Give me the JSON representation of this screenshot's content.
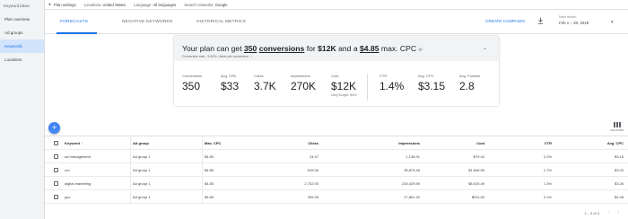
{
  "sidebar": {
    "title": "Keyword ideas",
    "items": [
      {
        "label": "Plan overview",
        "active": false
      },
      {
        "label": "Ad groups",
        "active": false
      },
      {
        "label": "Keywords",
        "active": true
      },
      {
        "label": "Locations",
        "active": false
      }
    ]
  },
  "topbar": {
    "plan_settings": "Plan settings",
    "locations_label": "Locations:",
    "locations_value": "United States",
    "language_label": "Language:",
    "language_value": "All languages",
    "networks_label": "Search networks:",
    "networks_value": "Google"
  },
  "tabs": [
    {
      "label": "FORECASTS",
      "active": true
    },
    {
      "label": "NEGATIVE KEYWORDS",
      "active": false
    },
    {
      "label": "HISTORICAL METRICS",
      "active": false
    }
  ],
  "actions": {
    "create_campaign": "CREATE CAMPAIGN"
  },
  "date_range": {
    "label": "Next month",
    "value": "Feb 1 – 28, 2019"
  },
  "plan": {
    "headline_prefix": "Your plan can get",
    "conversions_value": "350",
    "conversions_word": "conversions",
    "for_text": "for",
    "budget": "$12K",
    "and_text": "and a",
    "max_cpc": "$4.85",
    "max_cpc_suffix": "max. CPC",
    "subline": "Conversion rate : 9.49%, Value per conversion : –",
    "metrics": [
      {
        "label": "Conversions",
        "value": "350"
      },
      {
        "label": "Avg. CPA",
        "value": "$33"
      },
      {
        "label": "Clicks",
        "value": "3.7K"
      },
      {
        "label": "Impressions",
        "value": "270K"
      },
      {
        "label": "Cost",
        "value": "$12K",
        "sub": "Daily Budget: $500"
      },
      {
        "label": "CTR",
        "value": "1.4%"
      },
      {
        "label": "Avg. CPC",
        "value": "$3.15"
      },
      {
        "label": "Avg. Position",
        "value": "2.8"
      }
    ]
  },
  "fab_label": "+",
  "columns_label": "COLUMNS",
  "table": {
    "headers": [
      "Keyword",
      "Ad group",
      "Max. CPC",
      "Clicks",
      "Impressions",
      "Cost",
      "CTR",
      "Avg. CPC"
    ],
    "sort_indicator": "↑",
    "rows": [
      {
        "keyword": "ad management",
        "ad_group": "Ad group 1",
        "max_cpc": "$4.85",
        "clicks": "24.97",
        "impressions": "1,138.91",
        "cost": "$79.42",
        "ctr": "2.2%",
        "avg_cpc": "$3.18"
      },
      {
        "keyword": "cro",
        "ad_group": "Ad group 1",
        "max_cpc": "$4.85",
        "clicks": "615.06",
        "impressions": "35,873.46",
        "cost": "$1,846.95",
        "ctr": "1.7%",
        "avg_cpc": "$3.03"
      },
      {
        "keyword": "digital marketing",
        "ad_group": "Ad group 1",
        "max_cpc": "$4.85",
        "clicks": "2,732.93",
        "impressions": "215,429.59",
        "cost": "$8,915.49",
        "ctr": "1.3%",
        "avg_cpc": "$3.26"
      },
      {
        "keyword": "ppc",
        "ad_group": "Ad group 1",
        "max_cpc": "$4.85",
        "clicks": "306.99",
        "impressions": "17,861.32",
        "cost": "$911.63",
        "ctr": "2.1%",
        "avg_cpc": "$2.48"
      }
    ]
  },
  "pager": {
    "text": "1 – 4 of 4",
    "prev": "‹",
    "next": "›"
  }
}
